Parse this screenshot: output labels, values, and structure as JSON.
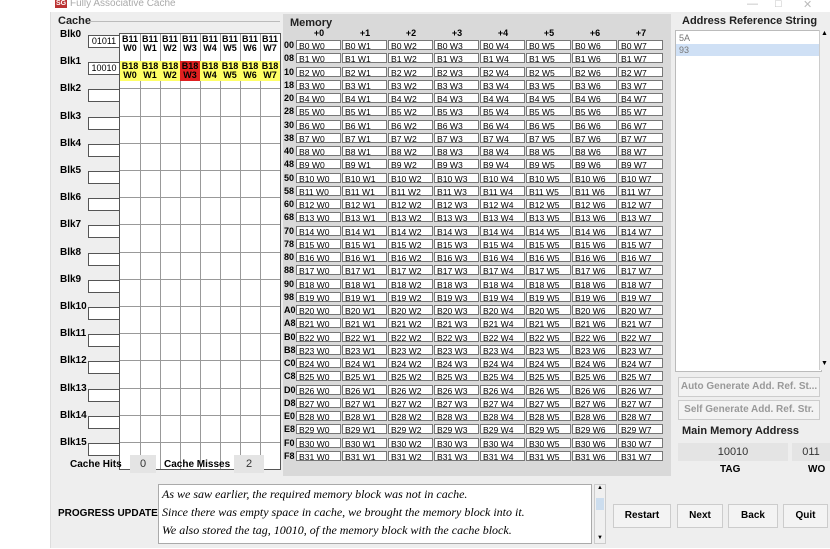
{
  "window": {
    "title": "Fully Associative Cache",
    "minimize": "—",
    "maximize": "□",
    "close": "✕",
    "app_icon": "SG"
  },
  "cache": {
    "title": "Cache",
    "words_header": [
      "W0",
      "W1",
      "W2",
      "W3",
      "W4",
      "W5",
      "W6",
      "W7"
    ],
    "blocks": [
      {
        "label": "Blk0",
        "tag": "01011",
        "line": "B11",
        "highlight": false
      },
      {
        "label": "Blk1",
        "tag": "10010",
        "line": "B18",
        "highlight": true
      },
      {
        "label": "Blk2",
        "tag": "",
        "line": "",
        "highlight": false
      },
      {
        "label": "Blk3",
        "tag": "",
        "line": "",
        "highlight": false
      },
      {
        "label": "Blk4",
        "tag": "",
        "line": "",
        "highlight": false
      },
      {
        "label": "Blk5",
        "tag": "",
        "line": "",
        "highlight": false
      },
      {
        "label": "Blk6",
        "tag": "",
        "line": "",
        "highlight": false
      },
      {
        "label": "Blk7",
        "tag": "",
        "line": "",
        "highlight": false
      },
      {
        "label": "Blk8",
        "tag": "",
        "line": "",
        "highlight": false
      },
      {
        "label": "Blk9",
        "tag": "",
        "line": "",
        "highlight": false
      },
      {
        "label": "Blk10",
        "tag": "",
        "line": "",
        "highlight": false
      },
      {
        "label": "Blk11",
        "tag": "",
        "line": "",
        "highlight": false
      },
      {
        "label": "Blk12",
        "tag": "",
        "line": "",
        "highlight": false
      },
      {
        "label": "Blk13",
        "tag": "",
        "line": "",
        "highlight": false
      },
      {
        "label": "Blk14",
        "tag": "",
        "line": "",
        "highlight": false
      },
      {
        "label": "Blk15",
        "tag": "",
        "line": "",
        "highlight": false
      }
    ],
    "highlight_word": 3,
    "colors": {
      "yellow": "#ffff66",
      "red": "#e02020"
    }
  },
  "stats": {
    "hits_label": "Cache Hits",
    "hits": "0",
    "misses_label": "Cache Misses",
    "misses": "2"
  },
  "memory": {
    "title": "Memory",
    "offsets": [
      "+0",
      "+1",
      "+2",
      "+3",
      "+4",
      "+5",
      "+6",
      "+7"
    ],
    "addresses": [
      "00",
      "08",
      "10",
      "18",
      "20",
      "28",
      "30",
      "38",
      "40",
      "48",
      "50",
      "58",
      "60",
      "68",
      "70",
      "78",
      "80",
      "88",
      "90",
      "98",
      "A0",
      "A8",
      "B0",
      "B8",
      "C0",
      "C8",
      "D0",
      "D8",
      "E0",
      "E8",
      "F0",
      "F8"
    ],
    "block_count": 32,
    "word_count": 8
  },
  "address_ref": {
    "title": "Address Reference String",
    "items": [
      "5A",
      "93"
    ],
    "selected_index": 1,
    "auto_button": "Auto Generate Add. Ref. St...",
    "self_button": "Self Generate Add. Ref. Str."
  },
  "main_memory_address": {
    "title": "Main Memory Address",
    "tag_value": "10010",
    "word_value": "011",
    "tag_label": "TAG",
    "word_label": "WO"
  },
  "progress": {
    "label": "PROGRESS UPDATE",
    "lines": [
      "As we saw earlier, the required memory block was not in cache.",
      "Since there was empty space in cache, we brought the memory block into it.",
      "We also stored the tag, 10010, of the memory block with the cache block."
    ]
  },
  "buttons": {
    "restart": "Restart",
    "next": "Next",
    "back": "Back",
    "quit": "Quit"
  }
}
